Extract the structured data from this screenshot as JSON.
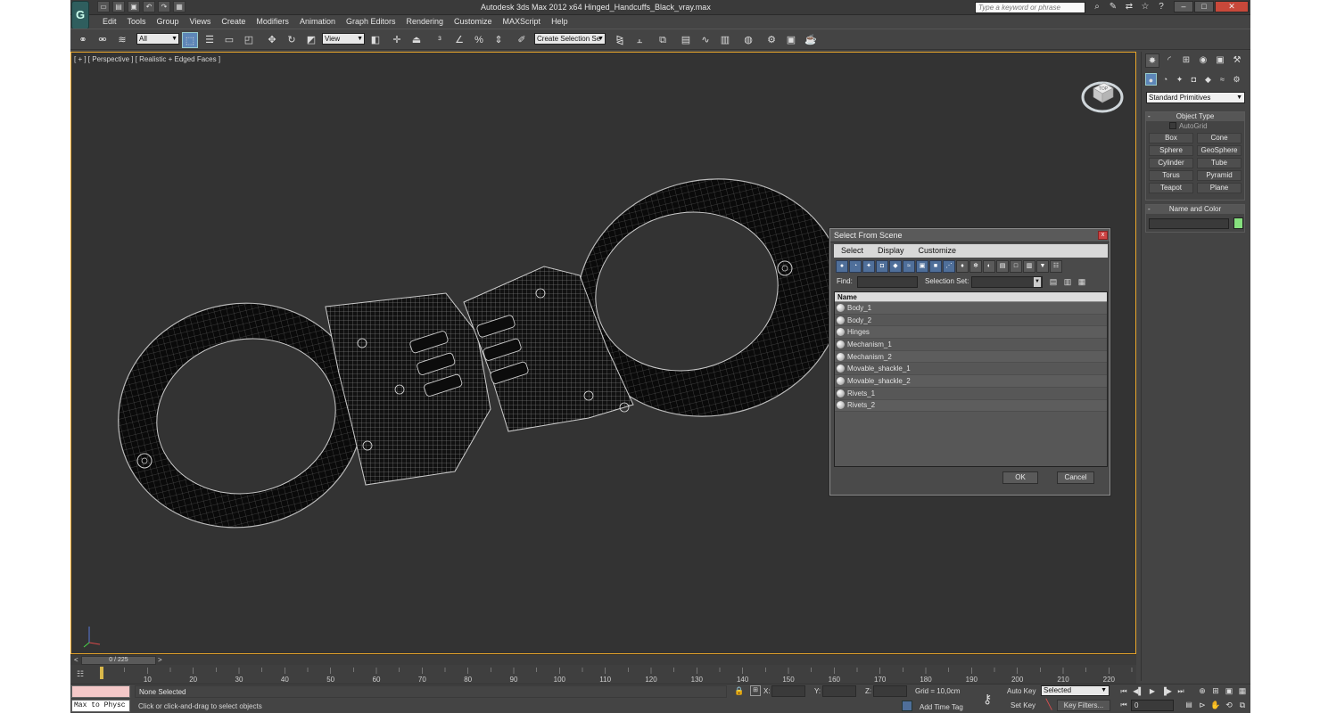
{
  "app": {
    "logo_glyph": "G",
    "window_title": "Autodesk 3ds Max  2012 x64      Hinged_Handcuffs_Black_vray.max",
    "search_placeholder": "Type a keyword or phrase",
    "quick_access": [
      "new-icon",
      "open-icon",
      "save-icon",
      "undo-icon",
      "redo-icon",
      "project-icon"
    ],
    "title_tools": [
      "binoculars-icon",
      "communication-icon",
      "exchange-icon",
      "star-icon",
      "help-icon"
    ],
    "win_ctrls": [
      "minimize",
      "maximize",
      "close"
    ]
  },
  "menubar": [
    "Edit",
    "Tools",
    "Group",
    "Views",
    "Create",
    "Modifiers",
    "Animation",
    "Graph Editors",
    "Rendering",
    "Customize",
    "MAXScript",
    "Help"
  ],
  "toolbar": {
    "filter_value": "All",
    "refcoord_value": "View",
    "named_selection_value": "Create Selection Se"
  },
  "viewport": {
    "label": "[ + ] [ Perspective ] [ Realistic + Edged Faces ]",
    "viewcube_face": "TOP",
    "border_color": "#e9a62a"
  },
  "dialog": {
    "title": "Select From Scene",
    "close_glyph": "x",
    "menus": [
      "Select",
      "Display",
      "Customize"
    ],
    "find_label": "Find:",
    "selection_set_label": "Selection Set:",
    "column_header": "Name",
    "objects": [
      "Body_1",
      "Body_2",
      "Hinges",
      "Mechanism_1",
      "Mechanism_2",
      "Movable_shackle_1",
      "Movable_shackle_2",
      "Rivets_1",
      "Rivets_2"
    ],
    "ok_label": "OK",
    "cancel_label": "Cancel"
  },
  "command_panel": {
    "primitive_type": "Standard Primitives",
    "object_type_title": "Object Type",
    "autogrid_label": "AutoGrid",
    "primitives": [
      "Box",
      "Cone",
      "Sphere",
      "GeoSphere",
      "Cylinder",
      "Tube",
      "Torus",
      "Pyramid",
      "Teapot",
      "Plane"
    ],
    "name_and_color_title": "Name and Color",
    "object_color": "#86e07e",
    "rollout_toggle": "-"
  },
  "timeline": {
    "frame_display": "0 / 225",
    "prev_glyph": "<",
    "next_glyph": ">",
    "ticks": [
      "10",
      "20",
      "30",
      "40",
      "50",
      "60",
      "70",
      "80",
      "90",
      "100",
      "110",
      "120",
      "130",
      "140",
      "150",
      "160",
      "170",
      "180",
      "190",
      "200",
      "210",
      "220"
    ]
  },
  "status": {
    "maxscript_text": "Max to Physc",
    "selection": "None Selected",
    "prompt": "Click or click-and-drag to select objects",
    "x_label": "X:",
    "y_label": "Y:",
    "z_label": "Z:",
    "grid": "Grid = 10,0cm",
    "add_time_tag": "Add Time Tag",
    "auto_key": "Auto Key",
    "set_key": "Set Key",
    "key_mode": "Selected",
    "key_filters": "Key Filters...",
    "current_frame": "0"
  }
}
